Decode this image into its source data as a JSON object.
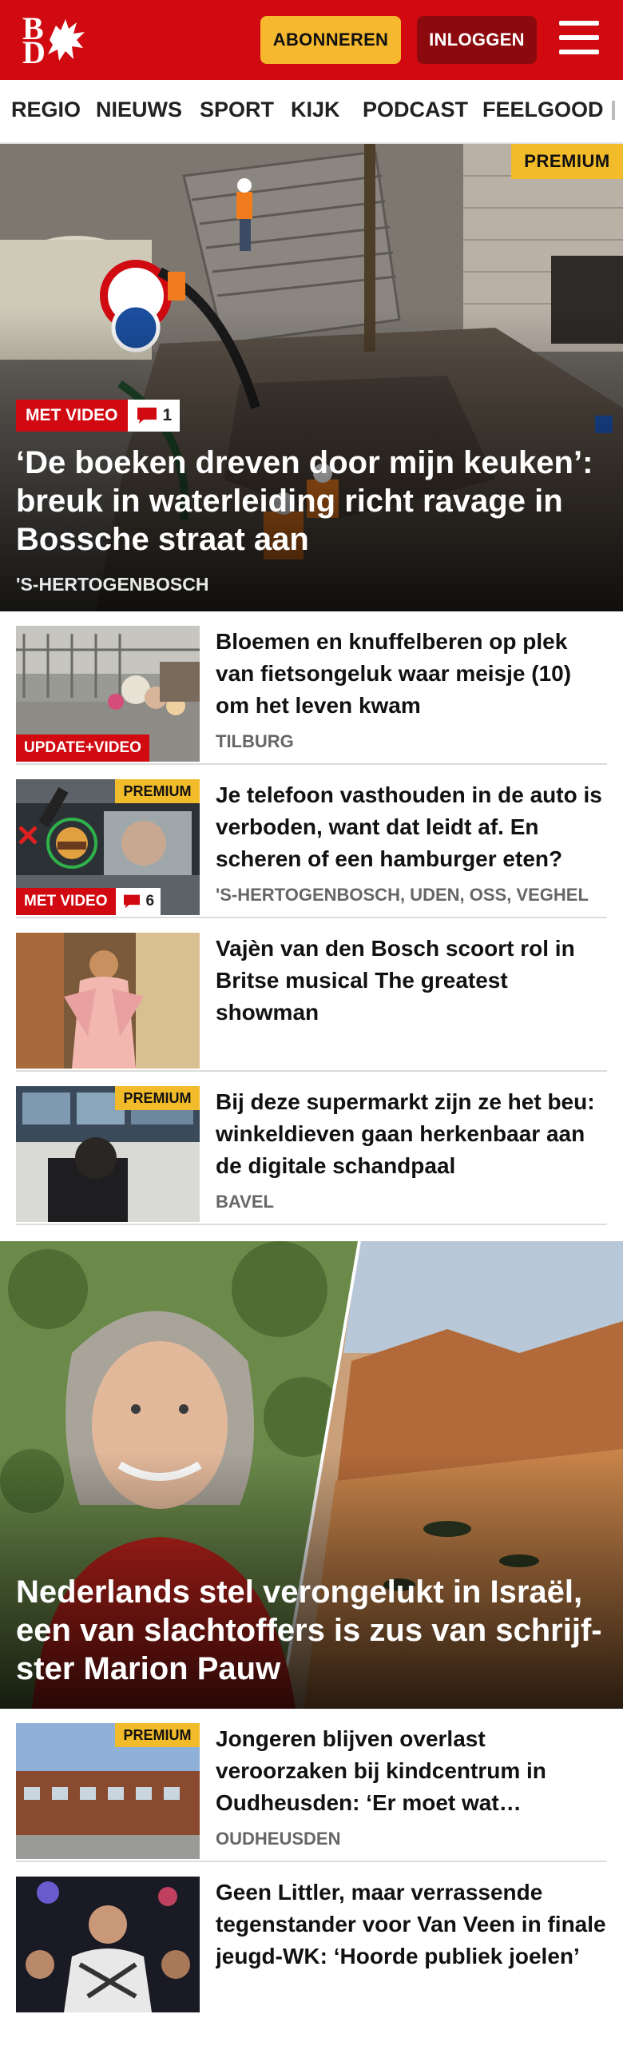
{
  "header": {
    "logo_top": "B",
    "logo_bottom": "D",
    "subscribe_label": "ABONNEREN",
    "login_label": "INLOGGEN",
    "brand_red": "#d10a11",
    "accent_yellow": "#f5b82e"
  },
  "nav": {
    "items": [
      "REGIO",
      "NIEUWS",
      "SPORT",
      "KIJK",
      "PODCAST",
      "FEELGOOD"
    ]
  },
  "hero": {
    "premium": "PREMIUM",
    "badge": "MET VIDEO",
    "comments": "1",
    "title": "‘De boeken dreven door mijn keuken’: breuk in waterleiding richt ravage in Bossche straat aan",
    "location": "'S-HERTOGENBOSCH"
  },
  "articles": [
    {
      "title": "Bloemen en knuffelberen op plek van fietsongeluk waar meisje (10) om het leven kwam",
      "location": "TILBURG",
      "badge": "UPDATE+VIDEO"
    },
    {
      "title": "Je telefoon vasthouden in de auto is verboden, want dat leidt af. En scheren of een hamburger eten?",
      "location": "'S-HERTOGENBOSCH, UDEN, OSS, VEGHEL",
      "premium": "PREMIUM",
      "badge": "MET VIDEO",
      "comments": "6"
    },
    {
      "title": "Vajèn van den Bosch scoort rol in Britse musical The greatest showman"
    },
    {
      "title": "Bij deze supermarkt zijn ze het beu: winkeldieven gaan herkenbaar aan de digitale schandpaal",
      "location": "BAVEL",
      "premium": "PREMIUM"
    }
  ],
  "feature": {
    "title": "Nederlands stel verongelukt in Israël, een van slachtoffers is zus van schrijf­ster Marion Pauw"
  },
  "articles2": [
    {
      "title": "Jongeren blijven overlast veroorzaken bij kindcentrum in Oudheusden: ‘Er moet wat gebeuren’",
      "location": "OUDHEUSDEN",
      "premium": "PREMIUM"
    },
    {
      "title": "Geen Littler, maar verrassende tegenstander voor Van Veen in finale jeugd-WK: ‘Hoorde publiek joelen’"
    }
  ],
  "icons": {
    "menu": "hamburger-icon",
    "comment": "speech-bubble-icon"
  }
}
